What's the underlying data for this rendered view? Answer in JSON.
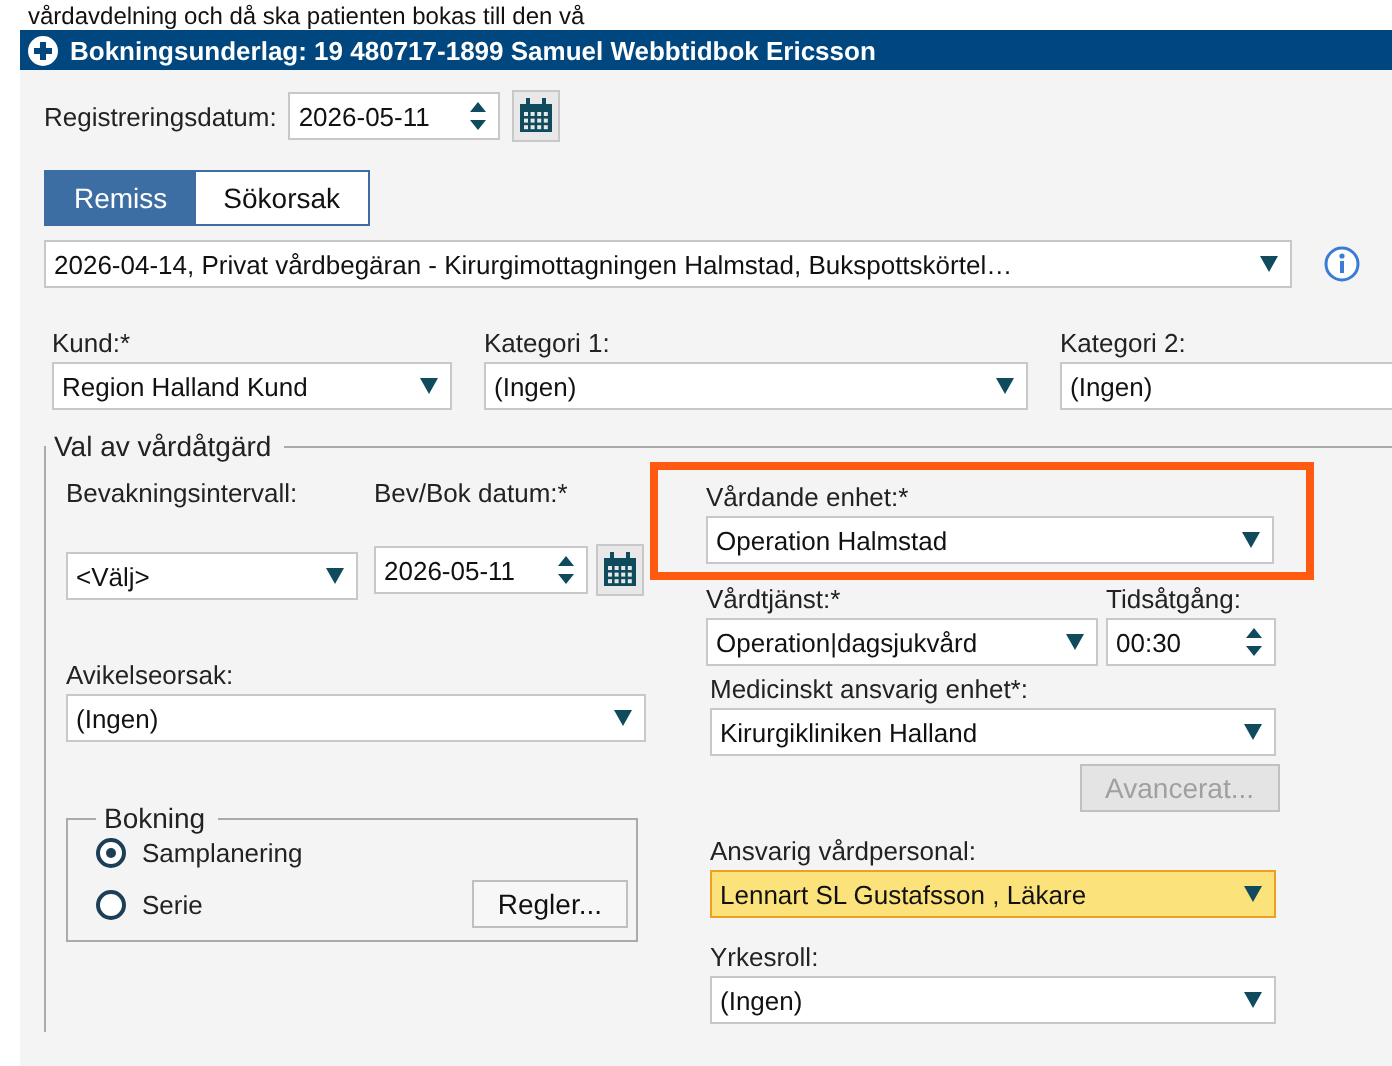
{
  "background_text": "vårdavdelning och då ska patienten bokas till den vå",
  "window": {
    "title": "Bokningsunderlag: 19 480717-1899 Samuel Webbtidbok Ericsson"
  },
  "registration": {
    "label": "Registreringsdatum:",
    "value": "2026-05-11"
  },
  "tabs": [
    {
      "label": "Remiss",
      "selected": true
    },
    {
      "label": "Sökorsak",
      "selected": false
    }
  ],
  "referral": {
    "value": "2026-04-14, Privat vårdbegäran  - Kirurgimottagningen Halmstad, Bukspottskörtel…"
  },
  "top_fields": [
    {
      "label": "Kund:*",
      "value": "Region Halland Kund"
    },
    {
      "label": "Kategori 1:",
      "value": "(Ingen)"
    },
    {
      "label": "Kategori 2:",
      "value": "(Ingen)"
    }
  ],
  "care_action": {
    "legend": "Val av vårdåtgärd",
    "interval": {
      "label": "Bevakningsintervall:",
      "value": "<Välj>"
    },
    "book_date": {
      "label": "Bev/Bok datum:*",
      "value": "2026-05-11"
    },
    "deviation": {
      "label": "Avikelseorsak:",
      "value": "(Ingen)"
    },
    "booking": {
      "legend": "Bokning",
      "options": [
        {
          "label": "Samplanering",
          "selected": true
        },
        {
          "label": "Serie",
          "selected": false
        }
      ],
      "button": "Regler..."
    },
    "care_unit": {
      "label": "Vårdande enhet:*",
      "value": "Operation Halmstad",
      "framed": true
    },
    "service": {
      "label": "Vårdtjänst:*",
      "value": "Operation|dagsjukvård"
    },
    "duration": {
      "label": "Tidsåtgång:",
      "value": "00:30"
    },
    "medical_unit": {
      "label": "Medicinskt ansvarig enhet*:",
      "value": "Kirurgikliniken Halland"
    },
    "advanced_button": {
      "label": "Avancerat...",
      "disabled": true
    },
    "staff": {
      "label": "Ansvarig vårdpersonal:",
      "value": "Lennart SL Gustafsson , Läkare",
      "highlighted": true
    },
    "role": {
      "label": "Yrkesroll:",
      "value": "(Ingen)"
    }
  }
}
